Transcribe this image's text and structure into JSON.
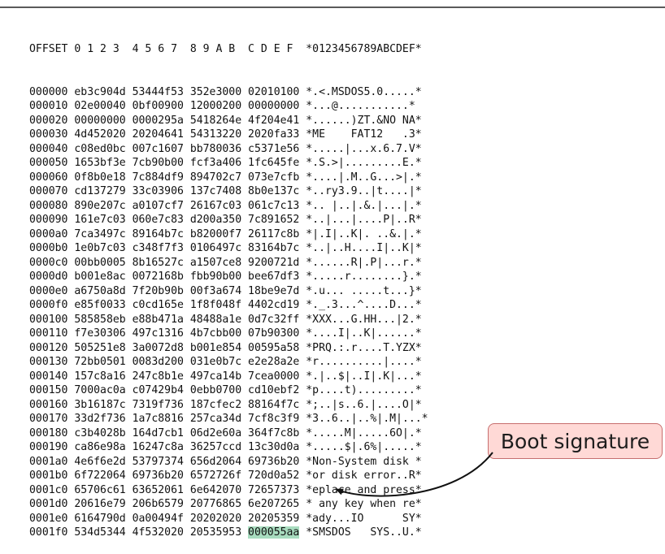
{
  "hex_dump": {
    "header": {
      "offset": "OFFSET",
      "col1": "0 1 2 3",
      "col2": "4 5 6 7",
      "col3": "8 9 A B",
      "col4": "C D E F",
      "ascii": "*0123456789ABCDEF*"
    },
    "rows": [
      {
        "offset": "000000",
        "g1": "eb3c904d",
        "g2": "53444f53",
        "g3": "352e3000",
        "g4": "02010100",
        "ascii": "*.<.MSDOS5.0.....*"
      },
      {
        "offset": "000010",
        "g1": "02e00040",
        "g2": "0bf00900",
        "g3": "12000200",
        "g4": "00000000",
        "ascii": "*...@...........*"
      },
      {
        "offset": "000020",
        "g1": "00000000",
        "g2": "0000295a",
        "g3": "5418264e",
        "g4": "4f204e41",
        "ascii": "*......)ZT.&NO NA*"
      },
      {
        "offset": "000030",
        "g1": "4d452020",
        "g2": "20204641",
        "g3": "54313220",
        "g4": "2020fa33",
        "ascii": "*ME    FAT12   .3*"
      },
      {
        "offset": "000040",
        "g1": "c08ed0bc",
        "g2": "007c1607",
        "g3": "bb780036",
        "g4": "c5371e56",
        "ascii": "*.....|...x.6.7.V*"
      },
      {
        "offset": "000050",
        "g1": "1653bf3e",
        "g2": "7cb90b00",
        "g3": "fcf3a406",
        "g4": "1fc645fe",
        "ascii": "*.S.>|.........E.*"
      },
      {
        "offset": "000060",
        "g1": "0f8b0e18",
        "g2": "7c884df9",
        "g3": "894702c7",
        "g4": "073e7cfb",
        "ascii": "*....|.M..G...>|.*"
      },
      {
        "offset": "000070",
        "g1": "cd137279",
        "g2": "33c03906",
        "g3": "137c7408",
        "g4": "8b0e137c",
        "ascii": "*..ry3.9..|t....|*"
      },
      {
        "offset": "000080",
        "g1": "890e207c",
        "g2": "a0107cf7",
        "g3": "26167c03",
        "g4": "061c7c13",
        "ascii": "*.. |..|.&.|...|.*"
      },
      {
        "offset": "000090",
        "g1": "161e7c03",
        "g2": "060e7c83",
        "g3": "d200a350",
        "g4": "7c891652",
        "ascii": "*..|...|....P|..R*"
      },
      {
        "offset": "0000a0",
        "g1": "7ca3497c",
        "g2": "89164b7c",
        "g3": "b82000f7",
        "g4": "26117c8b",
        "ascii": "*|.I|..K|. ..&.|.*"
      },
      {
        "offset": "0000b0",
        "g1": "1e0b7c03",
        "g2": "c348f7f3",
        "g3": "0106497c",
        "g4": "83164b7c",
        "ascii": "*..|..H....I|..K|*"
      },
      {
        "offset": "0000c0",
        "g1": "00bb0005",
        "g2": "8b16527c",
        "g3": "a1507ce8",
        "g4": "9200721d",
        "ascii": "*......R|.P|...r.*"
      },
      {
        "offset": "0000d0",
        "g1": "b001e8ac",
        "g2": "0072168b",
        "g3": "fbb90b00",
        "g4": "bee67df3",
        "ascii": "*.....r........}.*"
      },
      {
        "offset": "0000e0",
        "g1": "a6750a8d",
        "g2": "7f20b90b",
        "g3": "00f3a674",
        "g4": "18be9e7d",
        "ascii": "*.u... .....t...}*"
      },
      {
        "offset": "0000f0",
        "g1": "e85f0033",
        "g2": "c0cd165e",
        "g3": "1f8f048f",
        "g4": "4402cd19",
        "ascii": "*._.3...^....D...*"
      },
      {
        "offset": "000100",
        "g1": "585858eb",
        "g2": "e88b471a",
        "g3": "48488a1e",
        "g4": "0d7c32ff",
        "ascii": "*XXX...G.HH...|2.*"
      },
      {
        "offset": "000110",
        "g1": "f7e30306",
        "g2": "497c1316",
        "g3": "4b7cbb00",
        "g4": "07b90300",
        "ascii": "*....I|..K|......*"
      },
      {
        "offset": "000120",
        "g1": "505251e8",
        "g2": "3a0072d8",
        "g3": "b001e854",
        "g4": "00595a58",
        "ascii": "*PRQ.:.r....T.YZX*"
      },
      {
        "offset": "000130",
        "g1": "72bb0501",
        "g2": "0083d200",
        "g3": "031e0b7c",
        "g4": "e2e28a2e",
        "ascii": "*r..........|....*"
      },
      {
        "offset": "000140",
        "g1": "157c8a16",
        "g2": "247c8b1e",
        "g3": "497ca14b",
        "g4": "7cea0000",
        "ascii": "*.|..$|..I|.K|...*"
      },
      {
        "offset": "000150",
        "g1": "7000ac0a",
        "g2": "c07429b4",
        "g3": "0ebb0700",
        "g4": "cd10ebf2",
        "ascii": "*p....t).........*"
      },
      {
        "offset": "000160",
        "g1": "3b16187c",
        "g2": "7319f736",
        "g3": "187cfec2",
        "g4": "88164f7c",
        "ascii": "*;..|s..6.|....O|*"
      },
      {
        "offset": "000170",
        "g1": "33d2f736",
        "g2": "1a7c8816",
        "g3": "257ca34d",
        "g4": "7cf8c3f9",
        "ascii": "*3..6..|..%|.M|...*"
      },
      {
        "offset": "000180",
        "g1": "c3b4028b",
        "g2": "164d7cb1",
        "g3": "06d2e60a",
        "g4": "364f7c8b",
        "ascii": "*.....M|.....6O|.*"
      },
      {
        "offset": "000190",
        "g1": "ca86e98a",
        "g2": "16247c8a",
        "g3": "36257ccd",
        "g4": "13c30d0a",
        "ascii": "*.....$|.6%|.....*"
      },
      {
        "offset": "0001a0",
        "g1": "4e6f6e2d",
        "g2": "53797374",
        "g3": "656d2064",
        "g4": "69736b20",
        "ascii": "*Non-System disk *"
      },
      {
        "offset": "0001b0",
        "g1": "6f722064",
        "g2": "69736b20",
        "g3": "6572726f",
        "g4": "720d0a52",
        "ascii": "*or disk error..R*"
      },
      {
        "offset": "0001c0",
        "g1": "65706c61",
        "g2": "63652061",
        "g3": "6e642070",
        "g4": "72657373",
        "ascii": "*eplace and press*"
      },
      {
        "offset": "0001d0",
        "g1": "20616e79",
        "g2": "206b6579",
        "g3": "20776865",
        "g4": "6e207265",
        "ascii": "* any key when re*"
      },
      {
        "offset": "0001e0",
        "g1": "6164790d",
        "g2": "0a00494f",
        "g3": "20202020",
        "g4": "20205359",
        "ascii": "*ady...IO      SY*"
      },
      {
        "offset": "0001f0",
        "g1": "534d5344",
        "g2": "4f532020",
        "g3": "20535953",
        "g4": "000055aa",
        "ascii": "*SMSDOS   SYS..U.*"
      }
    ]
  },
  "annotation": {
    "label": "Boot signature"
  },
  "colors": {
    "highlight": "#a8dcbf",
    "annotation_fill": "#ffd9d6",
    "annotation_border": "#c76e6e",
    "arrow": "#111111"
  }
}
